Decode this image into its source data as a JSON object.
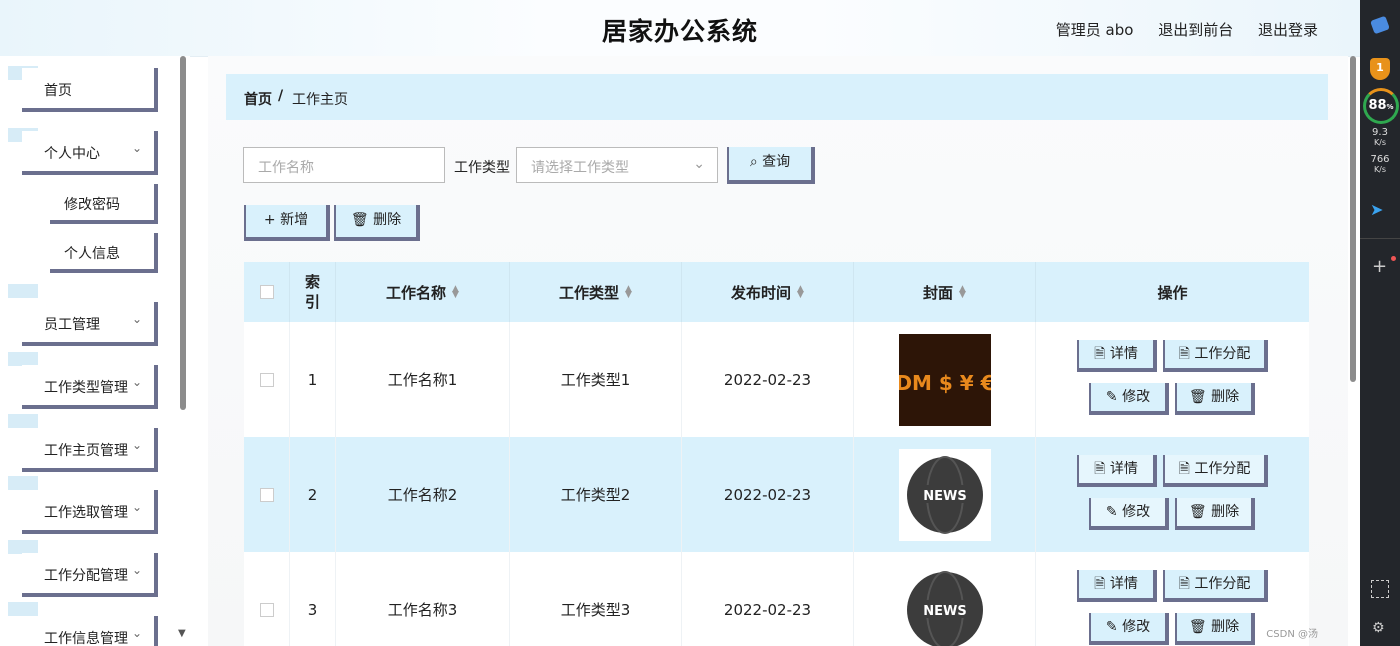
{
  "header": {
    "title": "居家办公系统",
    "admin": "管理员 abo",
    "to_front": "退出到前台",
    "logout": "退出登录"
  },
  "sidebar": {
    "items": [
      {
        "label": "首页"
      },
      {
        "label": "个人中心"
      },
      {
        "label": "员工管理"
      },
      {
        "label": "工作类型管理"
      },
      {
        "label": "工作主页管理"
      },
      {
        "label": "工作选取管理"
      },
      {
        "label": "工作分配管理"
      },
      {
        "label": "工作信息管理"
      }
    ],
    "sub": [
      {
        "label": "修改密码"
      },
      {
        "label": "个人信息"
      }
    ]
  },
  "breadcrumb": {
    "home": "首页",
    "sep": "/",
    "current": "工作主页"
  },
  "search": {
    "name_placeholder": "工作名称",
    "type_label": "工作类型",
    "type_placeholder": "请选择工作类型",
    "query": "查询"
  },
  "actions": {
    "add": "新增",
    "delete": "删除"
  },
  "table": {
    "headers": {
      "index": "索引",
      "name": "工作名称",
      "type": "工作类型",
      "date": "发布时间",
      "cover": "封面",
      "ops": "操作"
    },
    "rows": [
      {
        "index": "1",
        "name": "工作名称1",
        "type": "工作类型1",
        "date": "2022-02-23",
        "cover": "DM $ ¥ €"
      },
      {
        "index": "2",
        "name": "工作名称2",
        "type": "工作类型2",
        "date": "2022-02-23",
        "cover": "NEWS"
      },
      {
        "index": "3",
        "name": "工作名称3",
        "type": "工作类型3",
        "date": "2022-02-23",
        "cover": "NEWS"
      }
    ],
    "ops": {
      "detail": "详情",
      "assign": "工作分配",
      "edit": "修改",
      "delete": "删除"
    }
  },
  "extension": {
    "badge": "1",
    "percent": "88",
    "percent_sign": "%",
    "up_speed": "9.3",
    "down_speed": "766",
    "unit": "K/s"
  },
  "watermark": "CSDN @汤",
  "colors": {
    "accent_bg": "#d9f1fc",
    "btn_border": "#6b6f8e"
  }
}
